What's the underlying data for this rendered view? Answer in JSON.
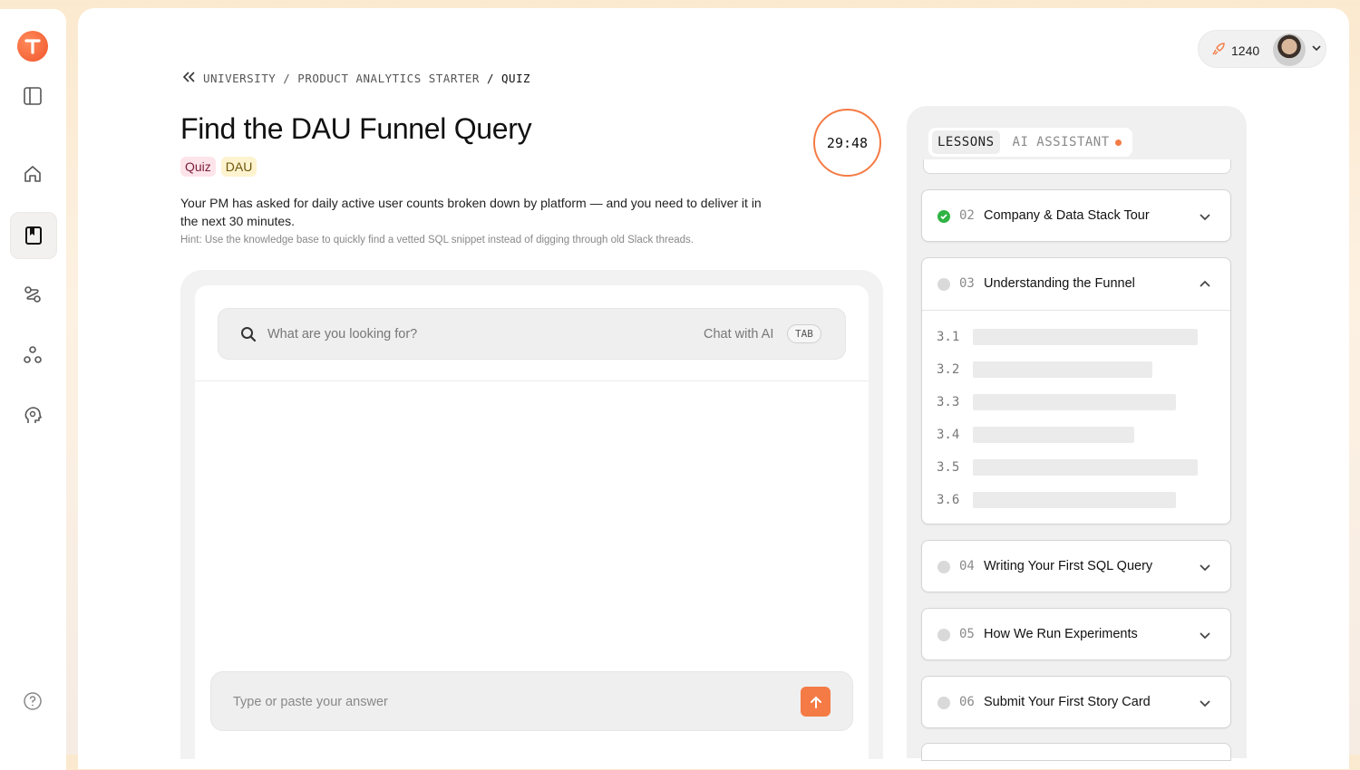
{
  "header": {
    "credits": "1240"
  },
  "breadcrumb": {
    "items": [
      "UNIVERSITY",
      "PRODUCT ANALYTICS STARTER"
    ],
    "current": "QUIZ",
    "sep": "/"
  },
  "quiz": {
    "title": "Find the DAU Funnel Query",
    "tags": [
      "Quiz",
      "DAU"
    ],
    "description": "Your PM has asked for daily active user counts broken down by platform — and you need to deliver it in the next 30 minutes.",
    "hint": "Hint: Use the knowledge base to quickly find a vetted SQL snippet instead of digging through old Slack threads.",
    "timer": "29:48"
  },
  "search": {
    "placeholder": "What are you looking for?",
    "chat_label": "Chat with AI",
    "shortcut": "TAB"
  },
  "answer": {
    "placeholder": "Type or paste your answer"
  },
  "side_tabs": {
    "lessons": "LESSONS",
    "assistant": "AI ASSISTANT"
  },
  "lessons": [
    {
      "num": "02",
      "title": "Company & Data Stack Tour",
      "status": "done"
    },
    {
      "num": "03",
      "title": "Understanding the Funnel",
      "status": "todo",
      "subitems": [
        "3.1",
        "3.2",
        "3.3",
        "3.4",
        "3.5",
        "3.6"
      ]
    },
    {
      "num": "04",
      "title": "Writing Your First SQL Query",
      "status": "todo"
    },
    {
      "num": "05",
      "title": "How We Run Experiments",
      "status": "todo"
    },
    {
      "num": "06",
      "title": "Submit Your First Story Card",
      "status": "todo"
    }
  ],
  "colors": {
    "accent": "#f47b45",
    "done": "#2fb344"
  },
  "icons": {
    "rail": [
      "logo-icon",
      "sidebar-toggle-icon",
      "home-icon",
      "book-icon",
      "path-icon",
      "nodes-icon",
      "brain-icon",
      "help-icon"
    ]
  }
}
